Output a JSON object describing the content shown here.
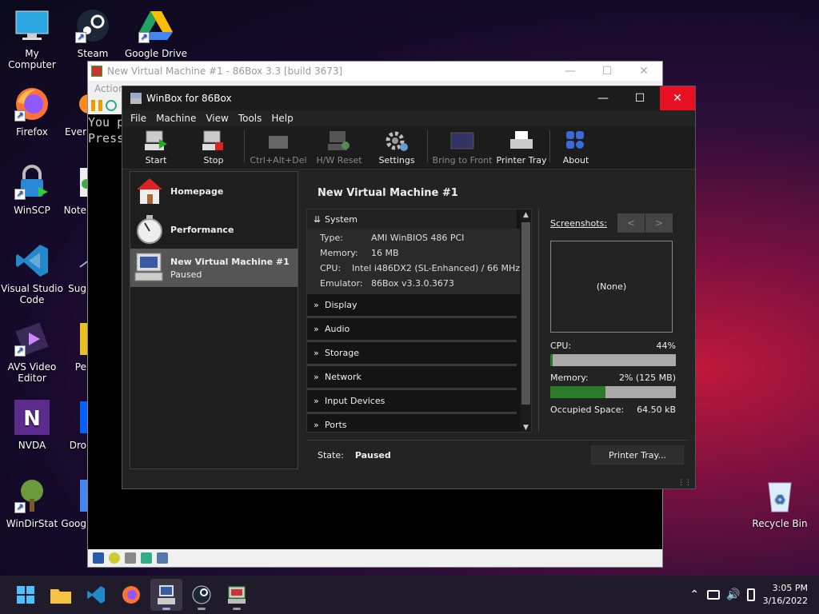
{
  "desktop": {
    "icons": [
      {
        "name": "my-computer",
        "label": "My Computer"
      },
      {
        "name": "steam",
        "label": "Steam"
      },
      {
        "name": "google-drive",
        "label": "Google Drive"
      },
      {
        "name": "firefox",
        "label": "Firefox"
      },
      {
        "name": "everything",
        "label": "Ever"
      },
      {
        "name": "winscp",
        "label": "WinSCP"
      },
      {
        "name": "notepad",
        "label": "Note"
      },
      {
        "name": "vscode",
        "label": "Visual Studio\nCode"
      },
      {
        "name": "sugar",
        "label": "Sug"
      },
      {
        "name": "avs",
        "label": "AVS Video\nEditor"
      },
      {
        "name": "pe",
        "label": "Pe"
      },
      {
        "name": "nvda",
        "label": "NVDA"
      },
      {
        "name": "dropbox",
        "label": "Dro"
      },
      {
        "name": "windirstat",
        "label": "WinDirStat"
      },
      {
        "name": "google",
        "label": "Goog"
      },
      {
        "name": "recycle-bin",
        "label": "Recycle Bin"
      }
    ]
  },
  "box86": {
    "title": "New Virtual Machine #1 - 86Box 3.3 [build 3673]",
    "menu": "Action",
    "console": [
      "You p",
      "Press"
    ]
  },
  "winbox": {
    "title": "WinBox for 86Box",
    "menu": [
      "File",
      "Machine",
      "View",
      "Tools",
      "Help"
    ],
    "toolbar": {
      "start": "Start",
      "stop": "Stop",
      "cad": "Ctrl+Alt+Del",
      "reset": "H/W Reset",
      "settings": "Settings",
      "front": "Bring to Front",
      "printer": "Printer Tray",
      "about": "About"
    },
    "sidebar": {
      "homepage": "Homepage",
      "performance": "Performance",
      "vm_name": "New Virtual Machine #1",
      "vm_state": "Paused"
    },
    "vm_title": "New Virtual Machine #1",
    "sections": {
      "system": "System",
      "display": "Display",
      "audio": "Audio",
      "storage": "Storage",
      "network": "Network",
      "input": "Input Devices",
      "ports": "Ports"
    },
    "system": {
      "type_k": "Type:",
      "type_v": "AMI WinBIOS 486 PCI",
      "mem_k": "Memory:",
      "mem_v": "16 MB",
      "cpu_k": "CPU:",
      "cpu_v": "Intel i486DX2 (SL-Enhanced) / 66 MHz",
      "emu_k": "Emulator:",
      "emu_v": "86Box v3.3.0.3673"
    },
    "screenshots": "Screenshots:",
    "screenshot_none": "(None)",
    "cpu_label": "CPU:",
    "cpu_value": "44%",
    "cpu_fraction": 0.02,
    "mem_label": "Memory:",
    "mem_value": "2% (125 MB)",
    "mem_fraction": 0.44,
    "space_label": "Occupied Space:",
    "space_value": "64.50 kB",
    "state_label": "State:",
    "state_value": "Paused",
    "printer_btn": "Printer Tray..."
  },
  "taskbar": {
    "time": "3:05 PM",
    "date": "3/16/2022"
  },
  "colors": {
    "accent": "#0078d4",
    "close_hover": "#e81123",
    "progress": "#2a7a2a"
  }
}
